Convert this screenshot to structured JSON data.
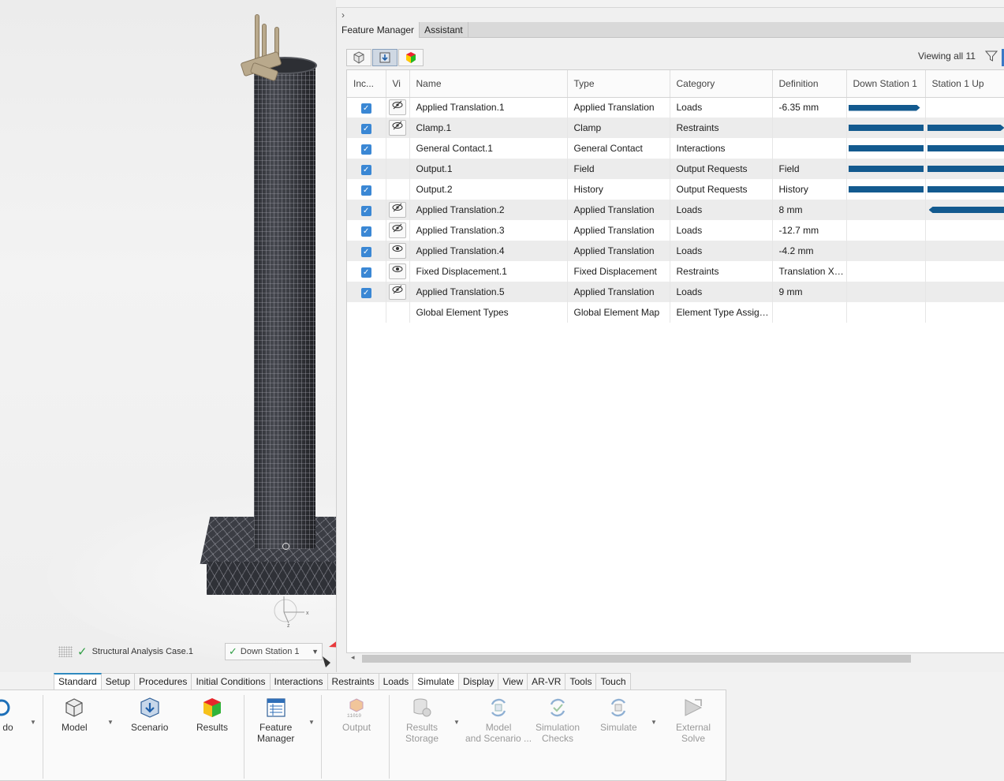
{
  "viewport": {
    "case_label": "Structural Analysis Case.1",
    "scenario_value": "Down Station 1",
    "axis_x": "x",
    "axis_z": "z"
  },
  "panel": {
    "tabs": [
      "Feature Manager",
      "Assistant"
    ],
    "active_tab": "Feature Manager",
    "viewing_text": "Viewing all 11",
    "columns": [
      "Inc...",
      "Vi",
      "Name",
      "Type",
      "Category",
      "Definition",
      "Down Station 1",
      "Station 1 Up"
    ],
    "rows": [
      {
        "included": true,
        "vis": "hidden",
        "name": "Applied Translation.1",
        "type": "Applied Translation",
        "category": "Loads",
        "definition": "-6.35 mm",
        "ds1": "arrow-end",
        "s1u": "none"
      },
      {
        "included": true,
        "vis": "hidden",
        "name": "Clamp.1",
        "type": "Clamp",
        "category": "Restraints",
        "definition": "",
        "ds1": "full",
        "s1u": "arrow-end"
      },
      {
        "included": true,
        "vis": "none",
        "name": "General Contact.1",
        "type": "General Contact",
        "category": "Interactions",
        "definition": "",
        "ds1": "full",
        "s1u": "full"
      },
      {
        "included": true,
        "vis": "none",
        "name": "Output.1",
        "type": "Field",
        "category": "Output Requests",
        "definition": "Field",
        "ds1": "full",
        "s1u": "full"
      },
      {
        "included": true,
        "vis": "none",
        "name": "Output.2",
        "type": "History",
        "category": "Output Requests",
        "definition": "History",
        "ds1": "full",
        "s1u": "full"
      },
      {
        "included": true,
        "vis": "hidden",
        "name": "Applied Translation.2",
        "type": "Applied Translation",
        "category": "Loads",
        "definition": "8 mm",
        "ds1": "none",
        "s1u": "arrow-start"
      },
      {
        "included": true,
        "vis": "hidden",
        "name": "Applied Translation.3",
        "type": "Applied Translation",
        "category": "Loads",
        "definition": "-12.7 mm",
        "ds1": "none",
        "s1u": "none"
      },
      {
        "included": true,
        "vis": "visible",
        "name": "Applied Translation.4",
        "type": "Applied Translation",
        "category": "Loads",
        "definition": "-4.2 mm",
        "ds1": "none",
        "s1u": "none"
      },
      {
        "included": true,
        "vis": "visible",
        "name": "Fixed Displacement.1",
        "type": "Fixed Displacement",
        "category": "Restraints",
        "definition": "Translation X, ...",
        "ds1": "none",
        "s1u": "none"
      },
      {
        "included": true,
        "vis": "hidden",
        "name": "Applied Translation.5",
        "type": "Applied Translation",
        "category": "Loads",
        "definition": "9 mm",
        "ds1": "none",
        "s1u": "none"
      },
      {
        "included": false,
        "vis": "none",
        "name": "Global Element Types",
        "type": "Global Element Map",
        "category": "Element Type Assign...",
        "definition": "",
        "ds1": "none",
        "s1u": "none"
      }
    ],
    "bar_color": "#135a8f"
  },
  "ribbon": {
    "tabs": [
      "Standard",
      "Setup",
      "Procedures",
      "Initial Conditions",
      "Interactions",
      "Restraints",
      "Loads",
      "Simulate",
      "Display",
      "View",
      "AR-VR",
      "Tools",
      "Touch"
    ],
    "active_tab": "Simulate",
    "partial_label": "do",
    "buttons": {
      "model": "Model",
      "scenario": "Scenario",
      "results": "Results",
      "feature_manager_1": "Feature",
      "feature_manager_2": "Manager",
      "output": "Output",
      "results_storage_1": "Results",
      "results_storage_2": "Storage",
      "model_scenario_1": "Model",
      "model_scenario_2": "and Scenario ...",
      "sim_checks_1": "Simulation",
      "sim_checks_2": "Checks",
      "simulate": "Simulate",
      "external_solve_1": "External",
      "external_solve_2": "Solve"
    }
  }
}
